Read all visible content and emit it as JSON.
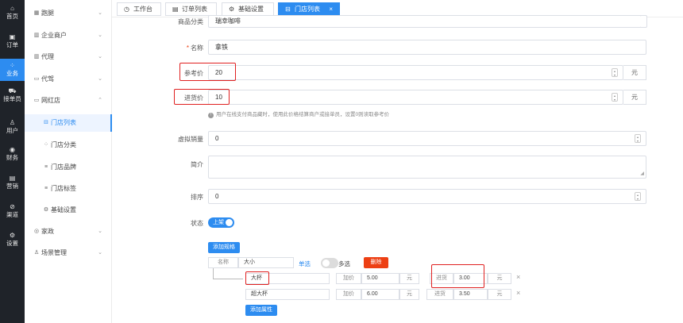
{
  "rail": [
    {
      "icon": "home-icon",
      "glyph": "⌂",
      "label": "首页"
    },
    {
      "icon": "order-icon",
      "glyph": "▣",
      "label": "订单"
    },
    {
      "icon": "business-icon",
      "glyph": "⁘",
      "label": "业务"
    },
    {
      "icon": "courier-icon",
      "glyph": "⛟",
      "label": "接单员"
    },
    {
      "icon": "user-icon",
      "glyph": "♙",
      "label": "用户"
    },
    {
      "icon": "finance-icon",
      "glyph": "◉",
      "label": "财务"
    },
    {
      "icon": "marketing-icon",
      "glyph": "▤",
      "label": "营销"
    },
    {
      "icon": "channel-icon",
      "glyph": "⊘",
      "label": "渠道"
    },
    {
      "icon": "settings-icon",
      "glyph": "⚙",
      "label": "设置"
    }
  ],
  "menu": [
    {
      "label": "跑腿",
      "glyph": "▦",
      "chev": "⌄"
    },
    {
      "label": "企业商户",
      "glyph": "▥",
      "chev": "⌄"
    },
    {
      "label": "代理",
      "glyph": "▥",
      "chev": "⌄"
    },
    {
      "label": "代驾",
      "glyph": "▭",
      "chev": "⌄"
    },
    {
      "label": "网红店",
      "glyph": "▭",
      "chev": "⌃"
    },
    {
      "label": "门店列表",
      "glyph": "⊟"
    },
    {
      "label": "门店分类",
      "glyph": "⁘"
    },
    {
      "label": "门店品牌",
      "glyph": "≡"
    },
    {
      "label": "门店标签",
      "glyph": "≡"
    },
    {
      "label": "基础设置",
      "glyph": "⚙"
    },
    {
      "label": "家政",
      "glyph": "◎",
      "chev": "⌄"
    },
    {
      "label": "场景管理",
      "glyph": "♙",
      "chev": "⌄"
    }
  ],
  "tabs": [
    {
      "label": "工作台",
      "glyph": "◷"
    },
    {
      "label": "订单列表",
      "glyph": "▤"
    },
    {
      "label": "基础设置",
      "glyph": "⚙"
    },
    {
      "label": "门店列表",
      "glyph": "⊟",
      "close": "×"
    }
  ],
  "form": {
    "category_label": "商品分类",
    "category_value": "瑞幸咖啡",
    "name_required": "*",
    "name_label": "名称",
    "name_value": "拿铁",
    "ref_price_label": "参考价",
    "ref_price_value": "20",
    "ref_price_unit": "元",
    "purchase_price_label": "进货价",
    "purchase_price_value": "10",
    "purchase_price_unit": "元",
    "hint": "用户在线支付商品藏时，使用此价格结算商户或接单员，设置0则读取参考价",
    "sales_label": "虚拟销量",
    "sales_value": "0",
    "intro_label": "简介",
    "sort_label": "排序",
    "sort_value": "0",
    "status_label": "状态",
    "status_value": "上架"
  },
  "attributes": {
    "add_spec_button": "添加规格",
    "name_label": "名称",
    "name_value": "大小",
    "single_label": "单选",
    "multi_label": "多选",
    "delete_button": "删除",
    "rows": [
      {
        "value": "大杯",
        "add_label": "加价",
        "add_value": "5.00",
        "add_unit": "元",
        "cost_label": "进货",
        "cost_value": "3.00",
        "cost_unit": "元"
      },
      {
        "value": "超大杯",
        "add_label": "加价",
        "add_value": "6.00",
        "add_unit": "元",
        "cost_label": "进货",
        "cost_value": "3.50",
        "cost_unit": "元"
      }
    ],
    "remove_glyph": "×",
    "add_attr_button": "添加属性"
  },
  "colors": {
    "primary": "#2d8cf0",
    "danger": "#ed4014",
    "highlight": "#e02020",
    "rail": "#1f2329"
  }
}
